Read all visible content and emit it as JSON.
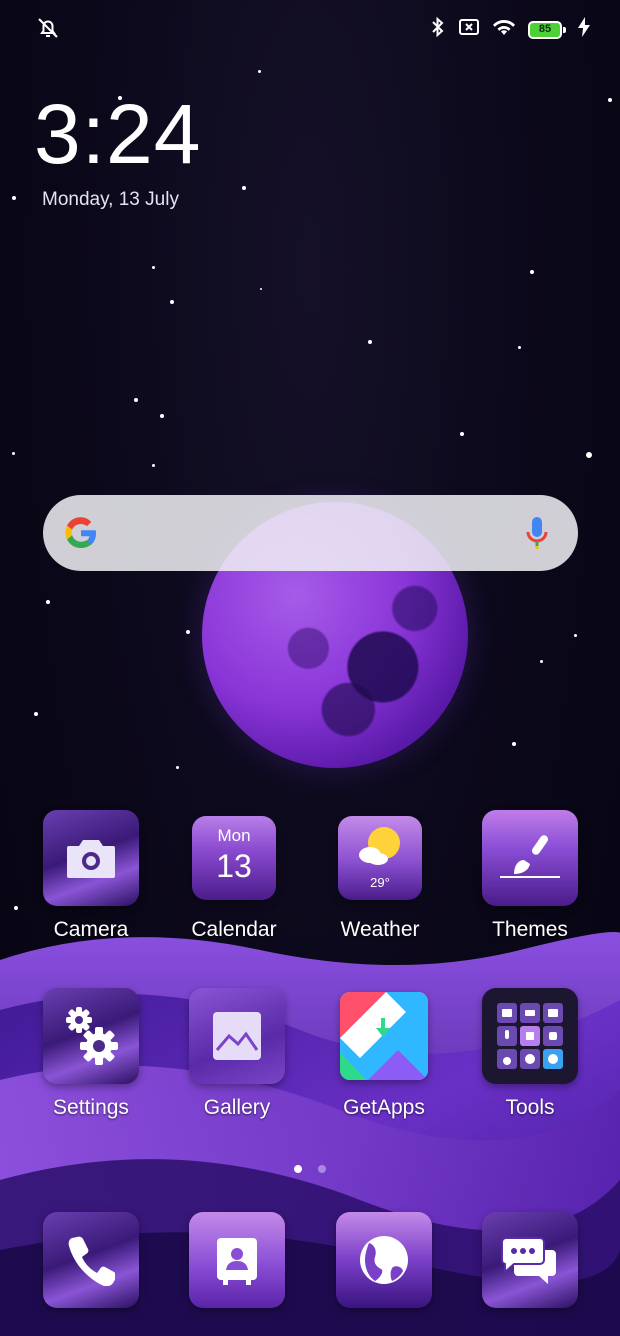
{
  "status": {
    "battery": "85"
  },
  "clock": {
    "time": "3:24",
    "date": "Monday, 13 July"
  },
  "search": {
    "icon": "google-g-icon",
    "mic": "mic-icon"
  },
  "apps": {
    "camera": "Camera",
    "calendar": {
      "label": "Calendar",
      "weekday": "Mon",
      "day": "13"
    },
    "weather": {
      "label": "Weather",
      "temp": "29°"
    },
    "themes": "Themes",
    "settings": "Settings",
    "gallery": "Gallery",
    "getapps": "GetApps",
    "tools": "Tools"
  },
  "dock": {
    "phone": "phone-icon",
    "contacts": "contacts-icon",
    "browser": "browser-icon",
    "messages": "messages-icon"
  },
  "pages": {
    "current": 1,
    "total": 2
  },
  "colors": {
    "accent": "#8a4fd0",
    "background": "#0a0718",
    "battery": "#4cd137"
  }
}
